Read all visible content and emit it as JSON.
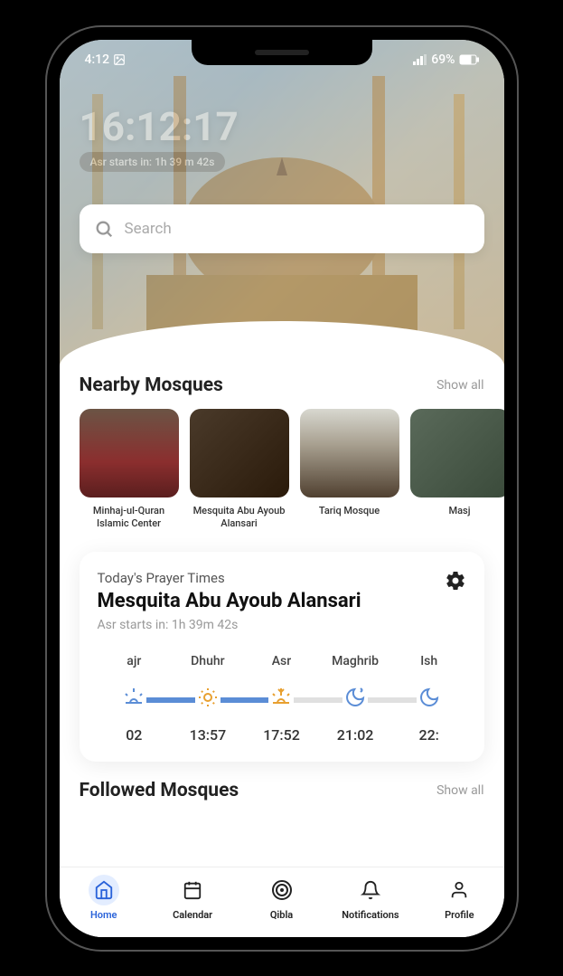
{
  "status": {
    "time": "4:12",
    "battery": "69%"
  },
  "hero": {
    "clock": "16:12:17",
    "countdown": "Asr starts in: 1h 39 m 42s",
    "search_placeholder": "Search"
  },
  "nearby": {
    "title": "Nearby Mosques",
    "show_all": "Show all",
    "items": [
      {
        "name": "Minhaj-ul-Quran Islamic Center"
      },
      {
        "name": "Mesquita Abu Ayoub Alansari"
      },
      {
        "name": "Tariq Mosque"
      },
      {
        "name": "Masj"
      }
    ]
  },
  "prayer": {
    "label": "Today's Prayer Times",
    "mosque": "Mesquita Abu Ayoub Alansari",
    "sub": "Asr starts in: 1h 39m 42s",
    "times": [
      {
        "name": "ajr",
        "time": "02"
      },
      {
        "name": "Dhuhr",
        "time": "13:57"
      },
      {
        "name": "Asr",
        "time": "17:52"
      },
      {
        "name": "Maghrib",
        "time": "21:02"
      },
      {
        "name": "Ish",
        "time": "22:"
      }
    ]
  },
  "followed": {
    "title": "Followed Mosques",
    "show_all": "Show all"
  },
  "tabs": {
    "home": "Home",
    "calendar": "Calendar",
    "qibla": "Qibla",
    "notifications": "Notifications",
    "profile": "Profile"
  }
}
